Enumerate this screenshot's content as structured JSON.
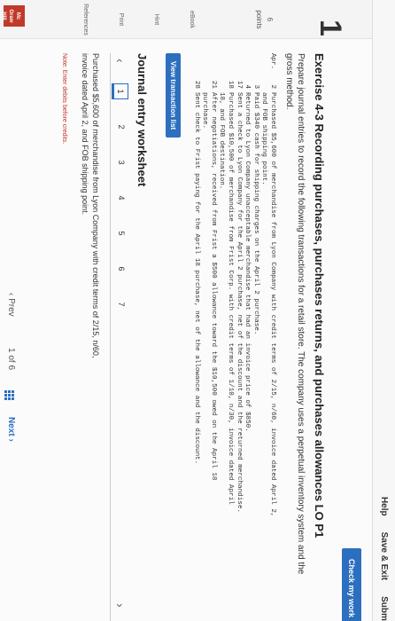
{
  "topbar": {
    "help": "Help",
    "save_exit": "Save & Exit",
    "submit": "Submit"
  },
  "rail": {
    "question_number": "1",
    "points_value": "6",
    "points_label": "points",
    "ebook": "eBook",
    "hint": "Hint",
    "print": "Print",
    "references": "References"
  },
  "header": {
    "check_my_work": "Check my work",
    "badge": "6"
  },
  "exercise": {
    "title": "Exercise 4-3 Recording purchases, purchases returns, and purchases allowances LO P1",
    "instructions": "Prepare journal entries to record the following transactions for a retail store. The company uses a perpetual inventory system and the gross method."
  },
  "transactions": [
    {
      "label": "Apr.",
      "day": "2",
      "text": "Purchased $5,600 of merchandise from Lyon Company with credit terms of 2/15, n/60, invoice dated April 2,"
    },
    {
      "label": "",
      "day": "",
      "text": "and FOB shipping point."
    },
    {
      "label": "",
      "day": "3",
      "text": "Paid $340 cash for shipping charges on the April 2 purchase."
    },
    {
      "label": "",
      "day": "4",
      "text": "Returned to Lyon Company unacceptable merchandise that had an invoice price of $850."
    },
    {
      "label": "",
      "day": "17",
      "text": "Sent a check to Lyon Company for the April 2 purchase, net of the discount and the returned merchandise."
    },
    {
      "label": "",
      "day": "18",
      "text": "Purchased $10,500 of merchandise from Frist Corp. with credit terms of 1/10, n/30, invoice dated April"
    },
    {
      "label": "",
      "day": "",
      "text": "18, and FOB destination."
    },
    {
      "label": "",
      "day": "21",
      "text": "After negotiations, received from Frist a $500 allowance toward the $10,500 owed on the April 18"
    },
    {
      "label": "",
      "day": "",
      "text": "purchase."
    },
    {
      "label": "",
      "day": "28",
      "text": "Sent check to Frist paying for the April 18 purchase, net of the allowance and the discount."
    }
  ],
  "buttons": {
    "view_transaction_list": "View transaction list"
  },
  "worksheet": {
    "title": "Journal entry worksheet",
    "pages": [
      "1",
      "2",
      "3",
      "4",
      "5",
      "6",
      "7"
    ],
    "active_page": "1",
    "description": "Purchased $5,600 of merchandise from Lyon Company with credit terms of 2/15, n/60, invoice dated April 2, and FOB shipping point.",
    "note": "Note: Enter debits before credits."
  },
  "bottom_nav": {
    "prev": "Prev",
    "position": "1 of 6",
    "next": "Next"
  },
  "logo": {
    "text": "Mc Graw Hill"
  },
  "colors": {
    "accent": "#2d6fbf",
    "logo": "#c0392b"
  }
}
